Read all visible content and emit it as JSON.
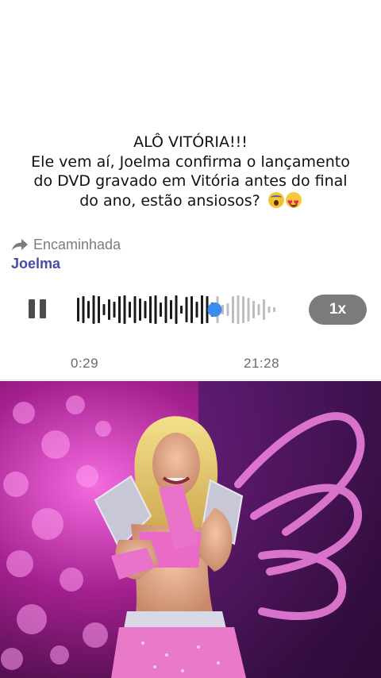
{
  "caption": {
    "line1": "ALÔ VITÓRIA!!!",
    "line2": "Ele vem aí, Joelma confirma o lançamento",
    "line3": "do DVD gravado em Vitória antes do final",
    "line4": "do ano, estão ansiosos?"
  },
  "message": {
    "forwarded_label": "Encaminhada",
    "sender": "Joelma"
  },
  "audio": {
    "speed_label": "1x",
    "elapsed": "0:29",
    "duration": "21:28",
    "progress": 0.68,
    "played_color": "#1a1a1a",
    "unplayed_color": "#bdbdbd",
    "scrubber_color": "#3b8cf0"
  },
  "photo": {
    "icon": "performer-photo"
  }
}
